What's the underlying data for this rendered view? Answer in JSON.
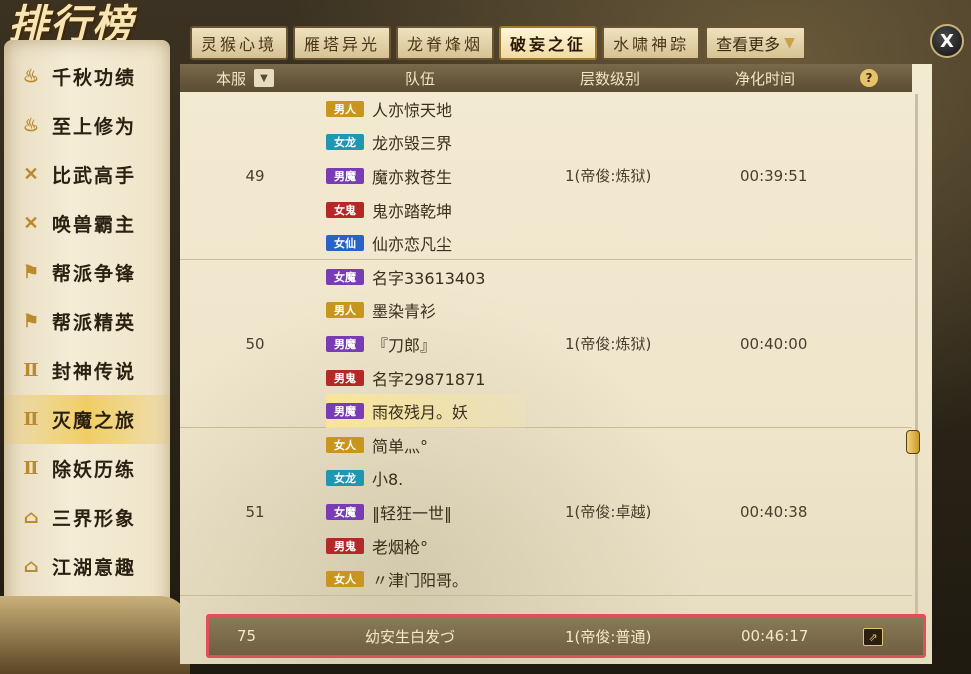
{
  "title": "排行榜",
  "close_label": "X",
  "sidebar": {
    "items": [
      {
        "label": "千秋功绩",
        "icon": "flame-icon",
        "glyph": "♨"
      },
      {
        "label": "至上修为",
        "icon": "flame-icon",
        "glyph": "♨"
      },
      {
        "label": "比武高手",
        "icon": "crossed-swords-icon",
        "glyph": "✕"
      },
      {
        "label": "唤兽霸主",
        "icon": "crossed-swords-icon",
        "glyph": "✕"
      },
      {
        "label": "帮派争锋",
        "icon": "banner-icon",
        "glyph": "⚑"
      },
      {
        "label": "帮派精英",
        "icon": "banner-icon",
        "glyph": "⚑"
      },
      {
        "label": "封神传说",
        "icon": "spirit-icon",
        "glyph": "Ⅱ"
      },
      {
        "label": "灭魔之旅",
        "icon": "spirit-icon",
        "glyph": "Ⅱ",
        "active": true
      },
      {
        "label": "除妖历练",
        "icon": "spirit-icon",
        "glyph": "Ⅱ"
      },
      {
        "label": "三界形象",
        "icon": "pavilion-icon",
        "glyph": "⌂"
      },
      {
        "label": "江湖意趣",
        "icon": "pavilion-icon",
        "glyph": "⌂"
      }
    ]
  },
  "tabs": [
    {
      "label": "灵猴心境",
      "active": false
    },
    {
      "label": "雁塔异光",
      "active": false
    },
    {
      "label": "龙脊烽烟",
      "active": false
    },
    {
      "label": "破妄之征",
      "active": true
    },
    {
      "label": "水啸神踪",
      "active": false
    }
  ],
  "more_label": "查看更多",
  "table": {
    "headers": {
      "rank": "本服",
      "team": "队伍",
      "layer": "层数级别",
      "time": "净化时间",
      "help": "?"
    },
    "groups": [
      {
        "rank": "49",
        "layer": "1(帝俊:炼狱)",
        "time": "00:39:51",
        "members": [
          {
            "badge": "男人",
            "color": "#c8961e",
            "name": "人亦惊天地"
          },
          {
            "badge": "女龙",
            "color": "#1e96b4",
            "name": "龙亦毁三界"
          },
          {
            "badge": "男魔",
            "color": "#7a3cb4",
            "name": "魔亦救苍生"
          },
          {
            "badge": "女鬼",
            "color": "#b42828",
            "name": "鬼亦踏乾坤"
          },
          {
            "badge": "女仙",
            "color": "#2864c8",
            "name": "仙亦恋凡尘"
          }
        ]
      },
      {
        "rank": "50",
        "layer": "1(帝俊:炼狱)",
        "time": "00:40:00",
        "members": [
          {
            "badge": "女魔",
            "color": "#7a3cb4",
            "name": "名字33613403"
          },
          {
            "badge": "男人",
            "color": "#c8961e",
            "name": "墨染青衫"
          },
          {
            "badge": "男魔",
            "color": "#7a3cb4",
            "name": "『刀郎』"
          },
          {
            "badge": "男鬼",
            "color": "#b42828",
            "name": "名字29871871"
          },
          {
            "badge": "男魔",
            "color": "#7a3cb4",
            "name": "雨夜残月。妖",
            "highlight": true
          }
        ]
      },
      {
        "rank": "51",
        "layer": "1(帝俊:卓越)",
        "time": "00:40:38",
        "members": [
          {
            "badge": "女人",
            "color": "#c8961e",
            "name": "简单灬°"
          },
          {
            "badge": "女龙",
            "color": "#1e96b4",
            "name": "小8."
          },
          {
            "badge": "女魔",
            "color": "#7a3cb4",
            "name": "‖轻狂一世‖"
          },
          {
            "badge": "男鬼",
            "color": "#b42828",
            "name": "老烟枪°"
          },
          {
            "badge": "女人",
            "color": "#c8961e",
            "name": "〃津门阳哥。"
          }
        ]
      }
    ]
  },
  "my_row": {
    "rank": "75",
    "name": "幼安生白发づ",
    "layer": "1(帝俊:普通)",
    "time": "00:46:17"
  }
}
